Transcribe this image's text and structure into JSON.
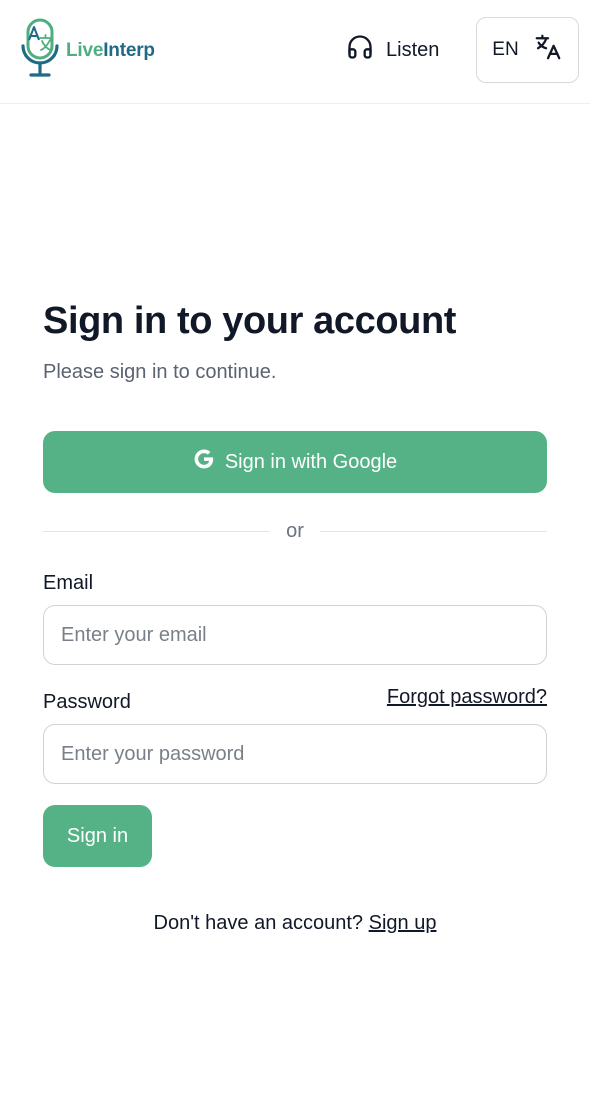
{
  "header": {
    "brand_live": "Live",
    "brand_interp": "Interp",
    "listen_label": "Listen",
    "language_code": "EN"
  },
  "form": {
    "title": "Sign in to your account",
    "subtitle": "Please sign in to continue.",
    "google_button_label": "Sign in with Google",
    "divider_text": "or",
    "email_label": "Email",
    "email_placeholder": "Enter your email",
    "email_value": "",
    "password_label": "Password",
    "password_placeholder": "Enter your password",
    "password_value": "",
    "forgot_password_label": "Forgot password?",
    "signin_button_label": "Sign in",
    "signup_prompt": "Don't have an account?",
    "signup_link_label": "Sign up"
  },
  "icons": {
    "logo": "microphone-translate-icon",
    "listen": "headphones-icon",
    "language": "translate-icon",
    "google": "google-g-icon"
  },
  "colors": {
    "primary": "#54b286",
    "brand_green": "#4fae81",
    "brand_blue": "#1f6a85",
    "text": "#111827",
    "muted": "#5b6270"
  }
}
